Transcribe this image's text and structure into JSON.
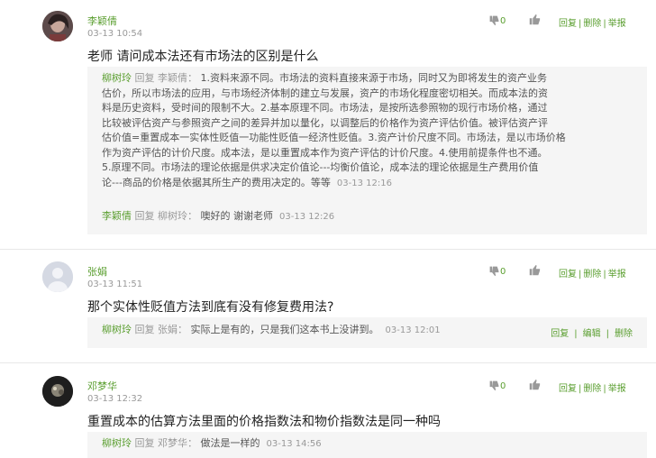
{
  "posts": [
    {
      "user": "李颖倩",
      "time": "03-13 10:54",
      "avatar_icon": "user-avatar-dark-hair",
      "question": "老师 请问成本法还有市场法的区别是什么",
      "dislike_count": "0",
      "actions": [
        "回复",
        "删除",
        "举报"
      ],
      "replies": [
        {
          "name": "柳树玲",
          "verb": "回复",
          "target": "李颖倩：",
          "lines": [
            "1.资料来源不同。市场法的资料直接来源于市场，同时又为即将发生的资产业务",
            "估价，所以市场法的应用，与市场经济体制的建立与发展，资产的市场化程度密切相关。而成本法的资",
            "料是历史资料，受时间的限制不大。2.基本原理不同。市场法，是按所选参照物的现行市场价格，通过",
            "比较被评估资产与参照资产之间的差异并加以量化，以调整后的价格作为资产评估价值。被评估资产评",
            "估价值=重置成本一实体性贬值一功能性贬值一经济性贬值。3.资产计价尺度不同。市场法，是以市场价格",
            "作为资产评估的计价尺度。成本法，是以重置成本作为资产评估的计价尺度。4.使用前提条件也不通。",
            "5.原理不同。市场法的理论依据是供求决定价值论---均衡价值论，成本法的理论依据是生产费用价值",
            "论---商品的价格是依据其所生产的费用决定的。等等"
          ],
          "time": "03-13 12:16"
        },
        {
          "name": "李颖倩",
          "verb": "回复",
          "target": "柳树玲：",
          "text": "噢好的 谢谢老师",
          "time": "03-13 12:26"
        }
      ]
    },
    {
      "user": "张娟",
      "time": "03-13 11:51",
      "avatar_icon": "default-user-avatar",
      "question": "那个实体性贬值方法到底有没有修复费用法?",
      "dislike_count": "0",
      "actions": [
        "回复",
        "删除",
        "举报"
      ],
      "replies": [
        {
          "name": "柳树玲",
          "verb": "回复",
          "target": "张娟：",
          "text": "实际上是有的，只是我们这本书上没讲到。",
          "time": "03-13 12:01",
          "actions": [
            "回复",
            "编辑",
            "删除"
          ]
        }
      ]
    },
    {
      "user": "邓梦华",
      "time": "03-13 12:32",
      "avatar_icon": "user-avatar-dark-photo",
      "question": "重置成本的估算方法里面的价格指数法和物价指数法是同一种吗",
      "dislike_count": "0",
      "actions": [
        "回复",
        "删除",
        "举报"
      ],
      "replies": [
        {
          "name": "柳树玲",
          "verb": "回复",
          "target": "邓梦华：",
          "text": "做法是一样的",
          "time": "03-13 14:56"
        }
      ]
    }
  ]
}
